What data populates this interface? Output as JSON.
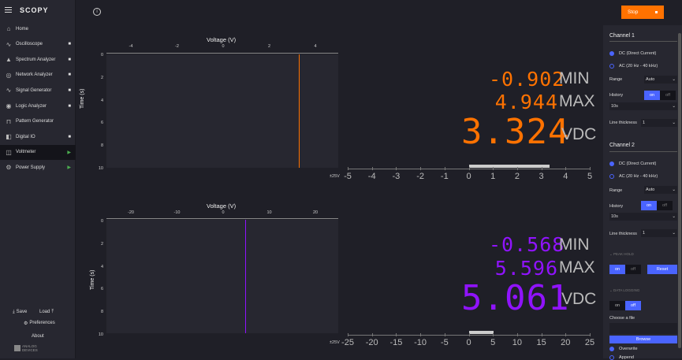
{
  "app": {
    "name": "SCOPY",
    "stop_label": "Stop"
  },
  "nav": [
    {
      "label": "Home",
      "icon": "home-icon",
      "glyph": "⌂",
      "ind": ""
    },
    {
      "label": "Oscilloscope",
      "icon": "oscilloscope-icon",
      "glyph": "∿",
      "ind": "■"
    },
    {
      "label": "Spectrum Analyzer",
      "icon": "spectrum-icon",
      "glyph": "▲",
      "ind": "■"
    },
    {
      "label": "Network Analyzer",
      "icon": "network-icon",
      "glyph": "◎",
      "ind": "■"
    },
    {
      "label": "Signal Generator",
      "icon": "signal-icon",
      "glyph": "∿",
      "ind": "■"
    },
    {
      "label": "Logic Analyzer",
      "icon": "logic-icon",
      "glyph": "◉",
      "ind": "■"
    },
    {
      "label": "Pattern Generator",
      "icon": "pattern-icon",
      "glyph": "⊓",
      "ind": ""
    },
    {
      "label": "Digital IO",
      "icon": "digital-io-icon",
      "glyph": "◧",
      "ind": "■"
    },
    {
      "label": "Voltmeter",
      "icon": "voltmeter-icon",
      "glyph": "◫",
      "ind": "▶"
    },
    {
      "label": "Power Supply",
      "icon": "power-icon",
      "glyph": "⚙",
      "ind": "▶"
    }
  ],
  "bottom": {
    "save": "Save",
    "load": "Load",
    "preferences": "Preferences",
    "about": "About",
    "brand": "ANALOG DEVICES"
  },
  "ch1": {
    "xlabel": "Voltage (V)",
    "ylabel": "Time (s)",
    "xticks": [
      "-4",
      "-2",
      "0",
      "2",
      "4"
    ],
    "yticks": [
      "0",
      "2",
      "4",
      "6",
      "8",
      "10"
    ],
    "min_val": "-0.902",
    "min_lbl": "MIN",
    "max_val": "4.944",
    "max_lbl": "MAX",
    "val": "3.324",
    "unit": "VDC",
    "scale_lbl": "±25V",
    "bar_ticks": [
      "-5",
      "-4",
      "-3",
      "-2",
      "-1",
      "0",
      "1",
      "2",
      "3",
      "4",
      "5"
    ]
  },
  "ch2": {
    "xlabel": "Voltage (V)",
    "ylabel": "Time (s)",
    "xticks": [
      "-20",
      "-10",
      "0",
      "10",
      "20"
    ],
    "yticks": [
      "0",
      "2",
      "4",
      "6",
      "8",
      "10"
    ],
    "min_val": "-0.568",
    "min_lbl": "MIN",
    "max_val": "5.596",
    "max_lbl": "MAX",
    "val": "5.061",
    "unit": "VDC",
    "scale_lbl": "±25V",
    "bar_ticks": [
      "-25",
      "-20",
      "-15",
      "-10",
      "-5",
      "0",
      "5",
      "10",
      "15",
      "20",
      "25"
    ]
  },
  "panel": {
    "ch1_title": "Channel 1",
    "ch2_title": "Channel 2",
    "dc": "DC (Direct Current)",
    "ac": "AC (20 Hz - 40 kHz)",
    "range": "Range",
    "range_val": "Auto",
    "history": "History",
    "on": "on",
    "off": "off",
    "history_val": "10s",
    "thickness": "Line thickness",
    "thickness_val": "1",
    "peak_hold": "PEAK HOLD",
    "reset": "Reset",
    "data_logging": "DATA LOGGING",
    "choose_file": "Choose a file",
    "browse": "Browse",
    "overwrite": "Overwrite",
    "append": "Append"
  },
  "colors": {
    "ch1": "#ff7200",
    "ch2": "#9013fe",
    "accent": "#4a64ff",
    "stop": "#ff7200"
  }
}
